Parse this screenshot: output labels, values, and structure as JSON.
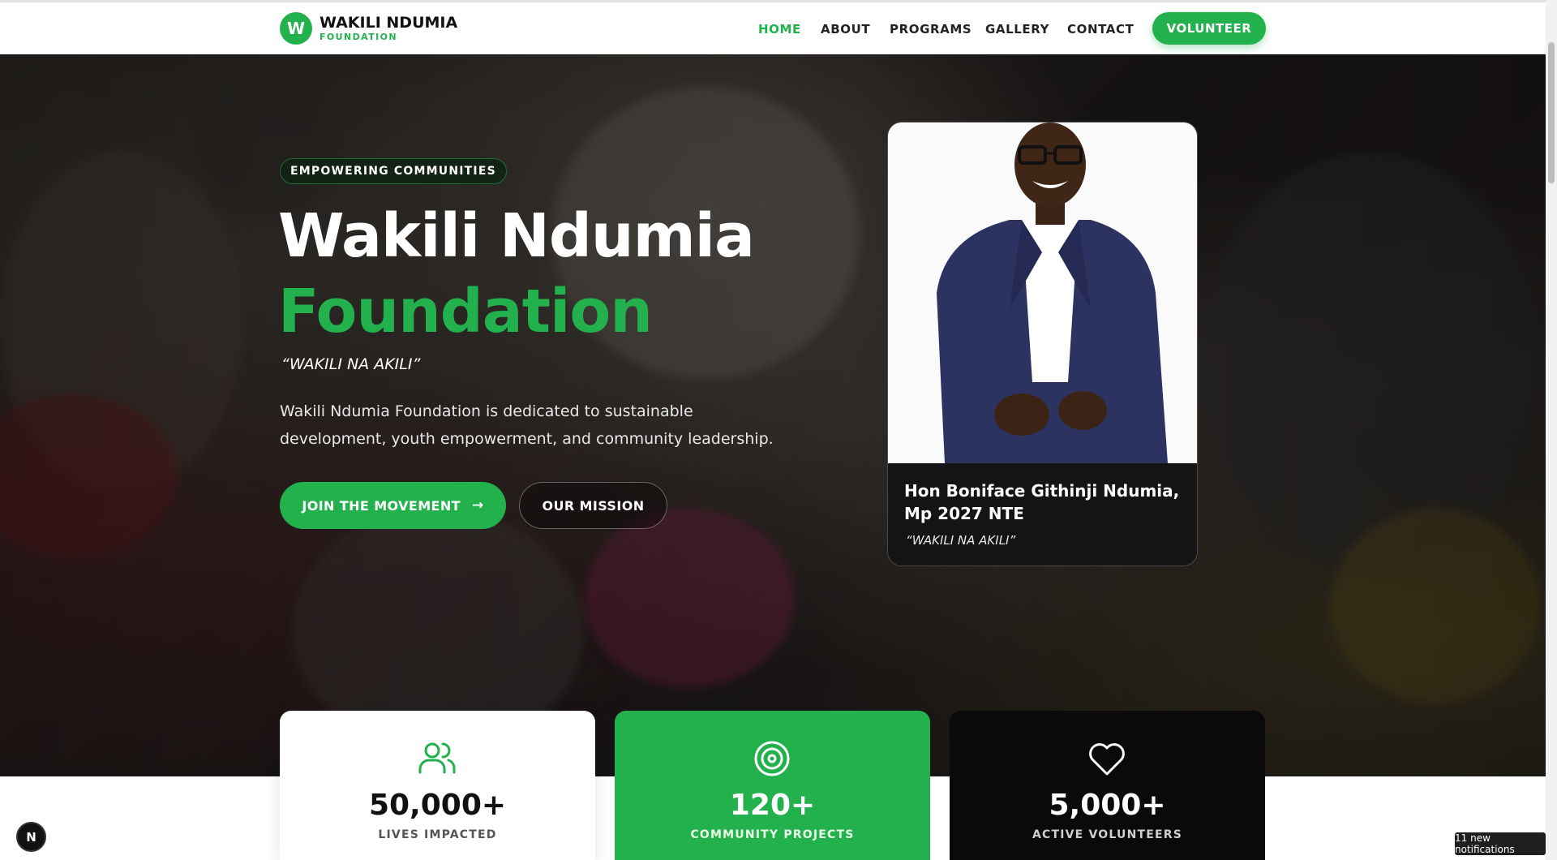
{
  "nav": {
    "logo_mark": "W",
    "logo_name": "WAKILI NDUMIA",
    "logo_sub": "FOUNDATION",
    "items": [
      {
        "label": "HOME",
        "active": true
      },
      {
        "label": "ABOUT",
        "active": false
      },
      {
        "label": "PROGRAMS",
        "active": false
      },
      {
        "label": "GALLERY",
        "active": false
      },
      {
        "label": "CONTACT",
        "active": false
      }
    ],
    "cta": "VOLUNTEER"
  },
  "hero": {
    "badge": "EMPOWERING COMMUNITIES",
    "title_line1": "Wakili Ndumia",
    "title_line2": "Foundation",
    "motto": "“WAKILI NA AKILI”",
    "description": "Wakili Ndumia Foundation is dedicated to sustainable development, youth empowerment, and community leadership.",
    "primary_button": "JOIN THE MOVEMENT",
    "secondary_button": "OUR MISSION"
  },
  "profile": {
    "name": "Hon Boniface Githinji Ndumia, Mp 2027 NTE",
    "motto": "“WAKILI NA AKILI”"
  },
  "stats": [
    {
      "value": "50,000+",
      "label": "LIVES IMPACTED",
      "icon": "users-icon"
    },
    {
      "value": "120+",
      "label": "COMMUNITY PROJECTS",
      "icon": "target-icon"
    },
    {
      "value": "5,000+",
      "label": "ACTIVE VOLUNTEERS",
      "icon": "heart-icon"
    }
  ],
  "floating": {
    "nextjs": "N",
    "notifications": "11 new notifications"
  },
  "colors": {
    "brand_green": "#22b14c",
    "dark": "#0a0a0a",
    "white": "#ffffff"
  }
}
